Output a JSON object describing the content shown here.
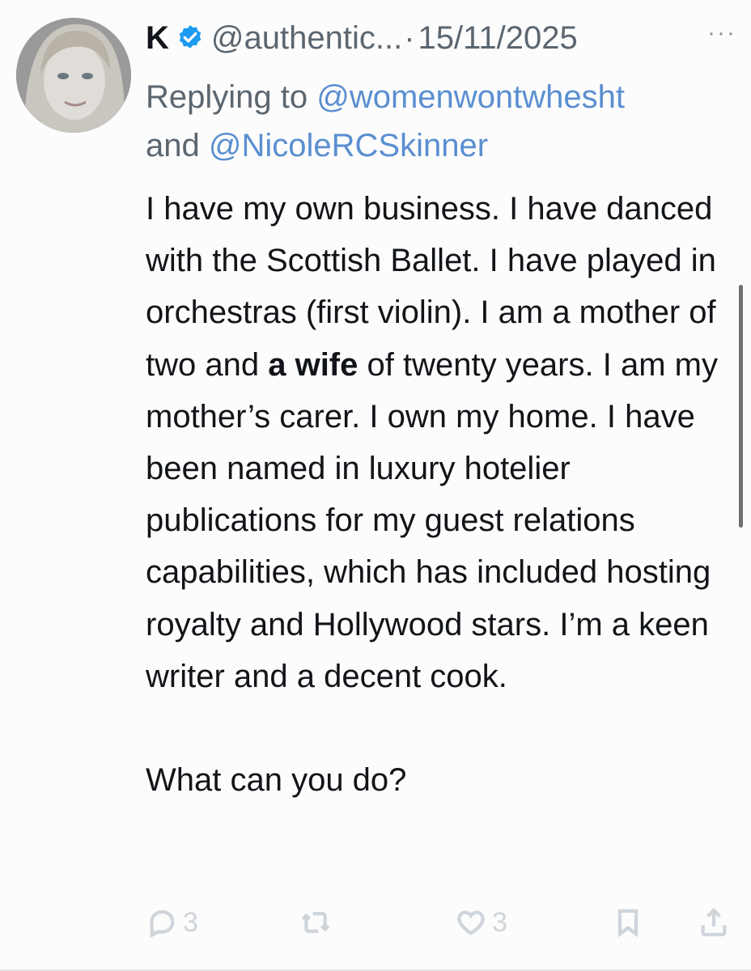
{
  "tweet": {
    "display_name": "K",
    "handle": "@authentic...",
    "separator": "·",
    "date": "15/11/2025",
    "more_label": "···",
    "replying_prefix": "Replying to",
    "mention_1": "@womenwontwhesht",
    "replying_and": "and",
    "mention_2": "@NicoleRCSkinner",
    "body_part_1": "I have my own business. I have danced with the Scottish Ballet. I have played in orchestras (first violin). I am a mother of two and ",
    "body_bold": "a wife",
    "body_part_2": " of twenty years. I am my mother’s carer. I own my home. I have been named in luxury hotelier publications for my guest relations capabilities, which has included hosting royalty and Hollywood stars. I’m a keen writer and a decent cook.",
    "question": "What can you do?"
  },
  "actions": {
    "reply_count": "3",
    "like_count": "3"
  },
  "colors": {
    "mention": "#5a8fd0",
    "verified": "#1d9bf0",
    "muted": "#5b6670",
    "icon": "#cfd5da"
  },
  "icons": [
    "verified-badge-icon",
    "more-icon",
    "reply-icon",
    "retweet-icon",
    "like-icon",
    "bookmark-icon",
    "share-icon"
  ]
}
